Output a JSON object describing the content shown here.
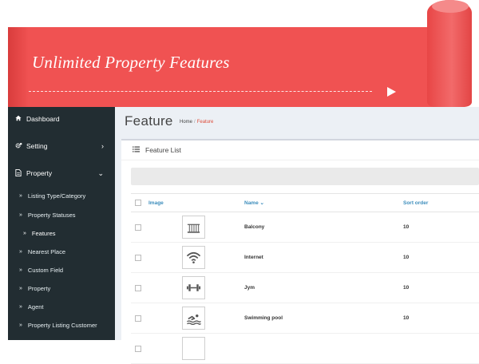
{
  "banner": {
    "title": "Unlimited Property Features"
  },
  "sidebar": {
    "items": [
      {
        "label": "Dashboard",
        "icon": "home-icon"
      },
      {
        "label": "Setting",
        "icon": "cogs-icon",
        "chevron": "›"
      },
      {
        "label": "Property",
        "icon": "file-icon",
        "chevron": "⌄"
      }
    ],
    "subitems": [
      {
        "label": "Listing Type/Category"
      },
      {
        "label": "Property Statuses"
      },
      {
        "label": "Features"
      },
      {
        "label": "Nearest Place"
      },
      {
        "label": "Custom Field"
      },
      {
        "label": "Property"
      },
      {
        "label": "Agent"
      },
      {
        "label": "Property Listing Customer"
      }
    ],
    "subitem_icon": "»"
  },
  "page": {
    "title": "Feature",
    "breadcrumb": {
      "home": "Home",
      "separator": "/",
      "current": "Feature"
    }
  },
  "box": {
    "title": "Feature List",
    "icon": "list-icon"
  },
  "table": {
    "columns": {
      "image": "Image",
      "name": "Name",
      "sort_icon": "⌄",
      "sort_order": "Sort order"
    },
    "rows": [
      {
        "name": "Balcony",
        "sort_order": "10",
        "icon": "balcony-icon"
      },
      {
        "name": "Internet",
        "sort_order": "10",
        "icon": "wifi-icon"
      },
      {
        "name": "Jym",
        "sort_order": "10",
        "icon": "dumbbell-icon"
      },
      {
        "name": "Swimming pool",
        "sort_order": "10",
        "icon": "swimming-icon"
      },
      {
        "name": "",
        "sort_order": "",
        "icon": ""
      }
    ]
  },
  "colors": {
    "banner": "#f05252",
    "sidebar": "#222d32",
    "link": "#3c8dbc",
    "breadcrumb_active": "#dd4b39",
    "content_bg": "#ecf0f5"
  }
}
